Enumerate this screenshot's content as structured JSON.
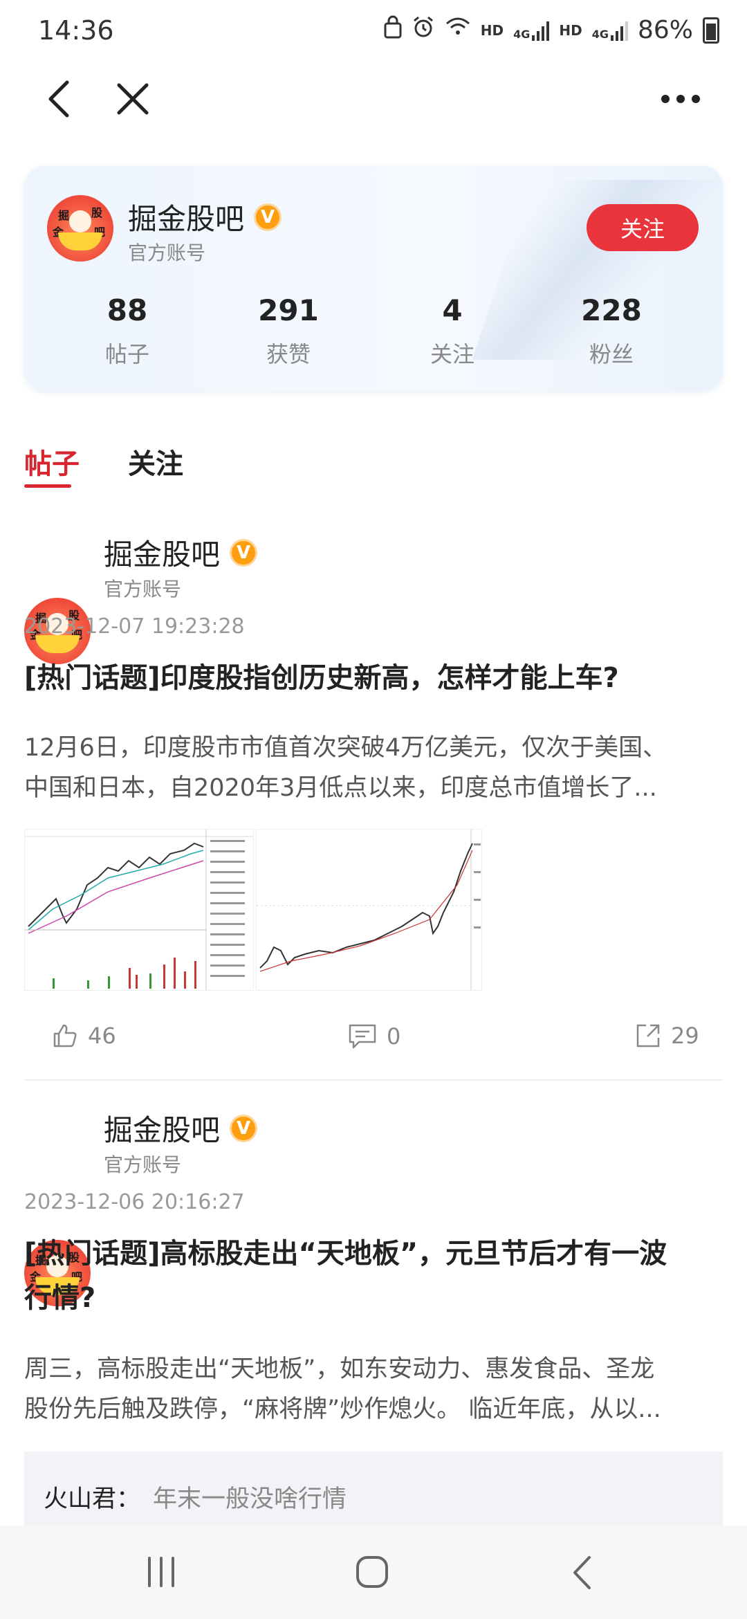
{
  "status_bar": {
    "time": "14:36",
    "hd1": "HD",
    "hd2": "HD",
    "signal1": "4G",
    "signal2": "4G",
    "battery": "86%"
  },
  "nav": {
    "back_icon": "chevron-left",
    "close_icon": "close",
    "more_icon": "more-horizontal"
  },
  "profile": {
    "name": "掘金股吧",
    "badge": "V",
    "subtitle": "官方账号",
    "follow_label": "关注",
    "avatar_text": [
      "掘",
      "股",
      "金",
      "吧"
    ],
    "stats": [
      {
        "value": "88",
        "label": "帖子"
      },
      {
        "value": "291",
        "label": "获赞"
      },
      {
        "value": "4",
        "label": "关注"
      },
      {
        "value": "228",
        "label": "粉丝"
      }
    ]
  },
  "tabs": [
    {
      "label": "帖子",
      "active": true
    },
    {
      "label": "关注",
      "active": false
    }
  ],
  "posts": [
    {
      "author": "掘金股吧",
      "badge": "V",
      "author_sub": "官方账号",
      "date": "2023-12-07 19:23:28",
      "title": "[热门话题]印度股指创历史新高，怎样才能上车?",
      "body_line1": "12月6日，印度股市市值首次突破4万亿美元，仅次于美国、",
      "body_line2": "中国和日本，自2020年3月低点以来，印度总市值增长了...",
      "likes": "46",
      "comments": "0",
      "shares": "29"
    },
    {
      "author": "掘金股吧",
      "badge": "V",
      "author_sub": "官方账号",
      "date": "2023-12-06 20:16:27",
      "title_line1": "[热门话题]高标股走出“天地板”，元旦节后才有一波",
      "title_line2": "行情?",
      "body_line1": "周三，高标股走出“天地板”，如东安动力、惠发食品、圣龙",
      "body_line2": "股份先后触及跌停，“麻将牌”炒作熄火。 临近年底，从以...",
      "comment_author": "火山君：",
      "comment_text": "年末一般没啥行情"
    }
  ],
  "colors": {
    "accent_red": "#e8343a",
    "tab_red": "#d9252f",
    "badge_orange": "#ff9f0f"
  }
}
